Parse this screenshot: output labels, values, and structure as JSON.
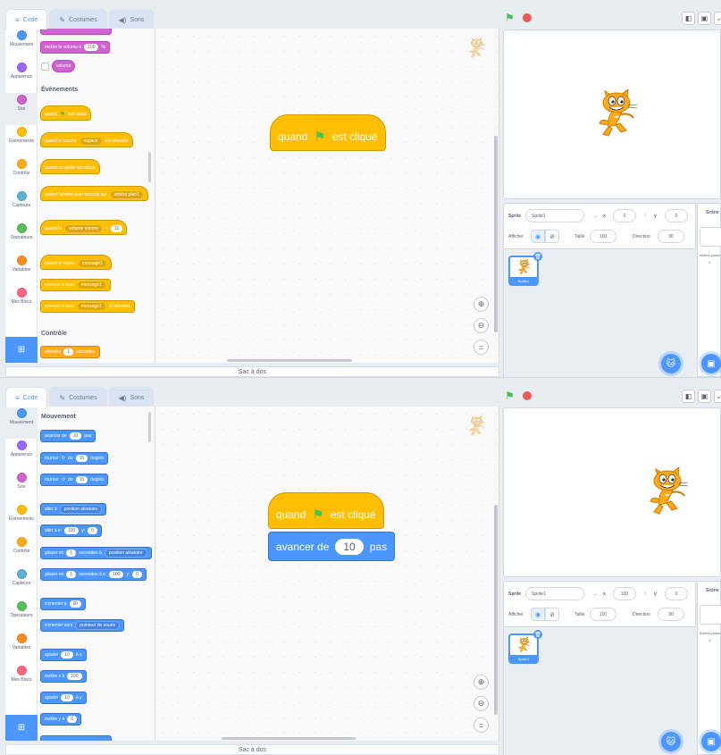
{
  "tabs": {
    "code": "Code",
    "costumes": "Costumes",
    "sounds": "Sons"
  },
  "categories": [
    "Mouvement",
    "Apparence",
    "Son",
    "Événements",
    "Contrôle",
    "Capteurs",
    "Opérateurs",
    "Variables",
    "Mes Blocs"
  ],
  "category_colors": [
    "#4c97ff",
    "#9966ff",
    "#cf63cf",
    "#ffbf00",
    "#ffab19",
    "#5cb1d6",
    "#59c059",
    "#ff8c1a",
    "#ff6680"
  ],
  "backpack": "Sac à dos",
  "frame1": {
    "selected_category": "Son",
    "palette": {
      "sound_volume_set": {
        "label": "mettre le volume à",
        "value": "100",
        "unit": "%"
      },
      "sound_volume_reporter": "volume",
      "events_title": "Événements",
      "when_flag": {
        "pre": "quand",
        "post": "est cliqué"
      },
      "when_key": {
        "pre": "quand la touche",
        "key": "espace",
        "post": "est pressée"
      },
      "when_sprite_clicked": "quand ce sprite est cliqué",
      "when_backdrop": {
        "pre": "quand l'arrière-plan bascule sur",
        "value": "arrière plan1"
      },
      "when_loudness": {
        "pre": "quand le",
        "sel": "volume sonore",
        "op": ">",
        "value": "10"
      },
      "when_receive": {
        "pre": "quand je reçois",
        "msg": "message1"
      },
      "broadcast": {
        "pre": "envoyer à tous",
        "msg": "message1"
      },
      "broadcast_wait": {
        "pre": "envoyer à tous",
        "msg": "message1",
        "post": "et attendre"
      },
      "control_title": "Contrôle",
      "wait": {
        "pre": "attendre",
        "value": "1",
        "post": "secondes"
      }
    },
    "script": {
      "hat_pre": "quand",
      "hat_post": "est cliqué"
    },
    "sprite": {
      "label": "Sprite",
      "name": "Sprite1",
      "x_label": "x",
      "x": "0",
      "y_label": "y",
      "y": "0",
      "show_label": "Afficher",
      "size_label": "Taille",
      "size": "100",
      "direction_label": "Direction",
      "direction": "90"
    }
  },
  "frame2": {
    "selected_category": "Mouvement",
    "palette": {
      "motion_title": "Mouvement",
      "move": {
        "pre": "avancer de",
        "value": "10",
        "post": "pas"
      },
      "turn_right": {
        "pre": "tourner",
        "mid": "de",
        "value": "15",
        "post": "degrés"
      },
      "turn_left": {
        "pre": "tourner",
        "mid": "de",
        "value": "15",
        "post": "degrés"
      },
      "goto": {
        "pre": "aller à",
        "sel": "position aléatoire"
      },
      "goto_xy": {
        "pre": "aller à x:",
        "x": "100",
        "y_label": "y:",
        "y": "0"
      },
      "glide_to": {
        "pre": "glisser en",
        "value": "1",
        "mid": "secondes à",
        "sel": "position aléatoire"
      },
      "glide_xy": {
        "pre": "glisser en",
        "value": "1",
        "mid": "secondes à x:",
        "x": "100",
        "y_label": "y:",
        "y": "0"
      },
      "point_dir": {
        "pre": "s'orienter à",
        "value": "90"
      },
      "point_towards": {
        "pre": "s'orienter vers",
        "sel": "pointeur de souris"
      },
      "change_x": {
        "pre": "ajouter",
        "value": "10",
        "post": "à x"
      },
      "set_x": {
        "pre": "mettre x à",
        "value": "100"
      },
      "change_y": {
        "pre": "ajouter",
        "value": "10",
        "post": "à y"
      },
      "set_y": {
        "pre": "mettre y à",
        "value": "0"
      }
    },
    "script": {
      "hat_pre": "quand",
      "hat_post": "est cliqué",
      "move_pre": "avancer de",
      "move_value": "10",
      "move_post": "pas"
    },
    "sprite": {
      "label": "Sprite",
      "name": "Sprite1",
      "x_label": "x",
      "x": "100",
      "y_label": "y",
      "y": "0",
      "show_label": "Afficher",
      "size_label": "Taille",
      "size": "100",
      "direction_label": "Direction",
      "direction": "90"
    }
  },
  "sprite_thumb_name": "Sprite1",
  "stage_panel": {
    "title": "Scène",
    "backdrops_label": "Arrière-plans",
    "backdrops_count": "1"
  },
  "icons": {
    "green_flag": "green-flag-icon",
    "stop": "stop-icon",
    "zoom_in": "zoom-in-icon",
    "zoom_out": "zoom-out-icon",
    "zoom_reset": "zoom-reset-icon",
    "extension": "add-extension-icon",
    "add_sprite": "add-sprite-icon",
    "add_backdrop": "add-backdrop-icon",
    "trash": "trash-icon"
  }
}
